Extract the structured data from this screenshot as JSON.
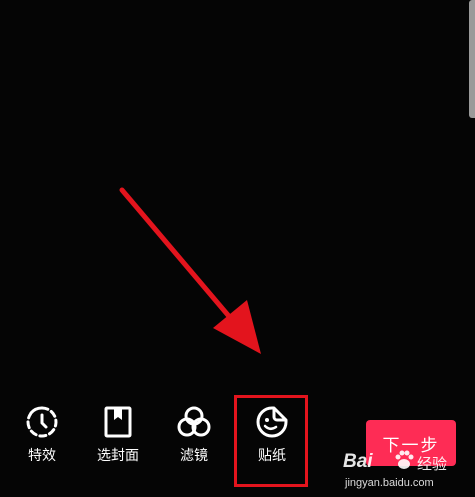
{
  "toolbar": {
    "items": [
      {
        "label": "特效",
        "icon": "effects-timer-icon"
      },
      {
        "label": "选封面",
        "icon": "cover-bookmark-icon"
      },
      {
        "label": "滤镜",
        "icon": "filter-circles-icon"
      },
      {
        "label": "贴纸",
        "icon": "sticker-icon"
      }
    ],
    "next_label": "下一步"
  },
  "annotation": {
    "highlighted_item": "贴纸",
    "color": "#e3141d"
  },
  "watermark": {
    "brand": "Bai",
    "brand_suffix": "经验",
    "url": "jingyan.baidu.com"
  },
  "colors": {
    "background": "#050505",
    "accent": "#fe2c55",
    "annotation": "#e3141d"
  }
}
